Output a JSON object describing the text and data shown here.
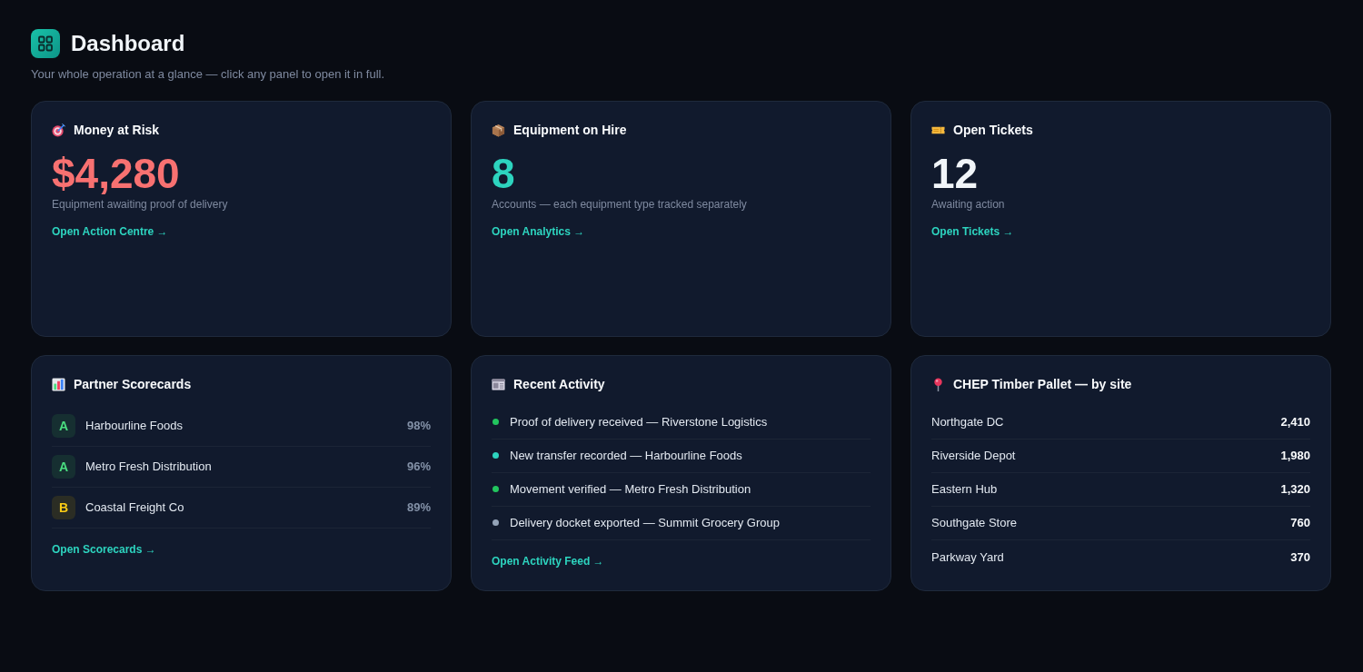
{
  "header": {
    "title": "Dashboard",
    "subtitle": "Your whole operation at a glance — click any panel to open it in full."
  },
  "panels": [
    {
      "kind": "metric",
      "title": "Money at Risk",
      "value": "$4,280",
      "color": "#f87171",
      "caption": "Equipment awaiting proof of delivery",
      "link": "Open Action Centre →"
    },
    {
      "kind": "metric",
      "title": "Equipment on Hire",
      "value": "8",
      "color": "#2dd4bf",
      "caption": "Accounts — each equipment type tracked separately",
      "link": "Open Analytics →"
    },
    {
      "kind": "metric",
      "title": "Open Tickets",
      "value": "12",
      "color": "#f1f5f9",
      "caption": "Awaiting action",
      "link": "Open Tickets →"
    },
    {
      "kind": "scorecards",
      "title": "Partner Scorecards",
      "rows": [
        {
          "grade": "A",
          "color": "#4ade80",
          "name": "Harbourline Foods",
          "score": "98%"
        },
        {
          "grade": "A",
          "color": "#4ade80",
          "name": "Metro Fresh Distribution",
          "score": "96%"
        },
        {
          "grade": "B",
          "color": "#facc15",
          "name": "Coastal Freight Co",
          "score": "89%"
        }
      ],
      "link": "Open Scorecards →"
    },
    {
      "kind": "activity",
      "title": "Recent Activity",
      "items": [
        {
          "color": "#22c55e",
          "text": "Proof of delivery received — Riverstone Logistics"
        },
        {
          "color": "#2dd4bf",
          "text": "New transfer recorded — Harbourline Foods"
        },
        {
          "color": "#22c55e",
          "text": "Movement verified — Metro Fresh Distribution"
        },
        {
          "color": "#94a3b8",
          "text": "Delivery docket exported — Summit Grocery Group"
        }
      ],
      "link": "Open Activity Feed →"
    },
    {
      "kind": "sites",
      "title": "CHEP Timber Pallet — by site",
      "rows": [
        {
          "site": "Northgate DC",
          "count": "2,410"
        },
        {
          "site": "Riverside Depot",
          "count": "1,980"
        },
        {
          "site": "Eastern Hub",
          "count": "1,320"
        },
        {
          "site": "Southgate Store",
          "count": "760"
        },
        {
          "site": "Parkway Yard",
          "count": "370"
        }
      ]
    }
  ]
}
